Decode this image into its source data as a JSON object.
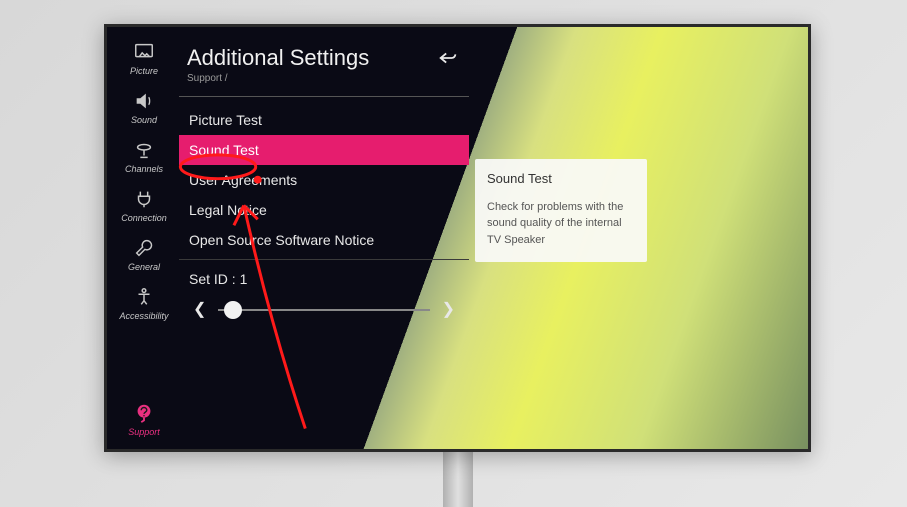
{
  "sidebar": {
    "items": [
      {
        "label": "Picture"
      },
      {
        "label": "Sound"
      },
      {
        "label": "Channels"
      },
      {
        "label": "Connection"
      },
      {
        "label": "General"
      },
      {
        "label": "Accessibility"
      }
    ],
    "footer": {
      "label": "Support"
    }
  },
  "header": {
    "title": "Additional Settings",
    "breadcrumb": "Support /"
  },
  "menu": {
    "items": [
      {
        "label": "Picture Test"
      },
      {
        "label": "Sound Test"
      },
      {
        "label": "User Agreements"
      },
      {
        "label": "Legal Notice"
      },
      {
        "label": "Open Source Software Notice"
      },
      {
        "label": "Set ID : 1"
      }
    ],
    "selected_index": 1
  },
  "tooltip": {
    "title": "Sound Test",
    "body": "Check for problems with the sound quality of the internal TV Speaker"
  },
  "colors": {
    "accent": "#e61d6e"
  }
}
